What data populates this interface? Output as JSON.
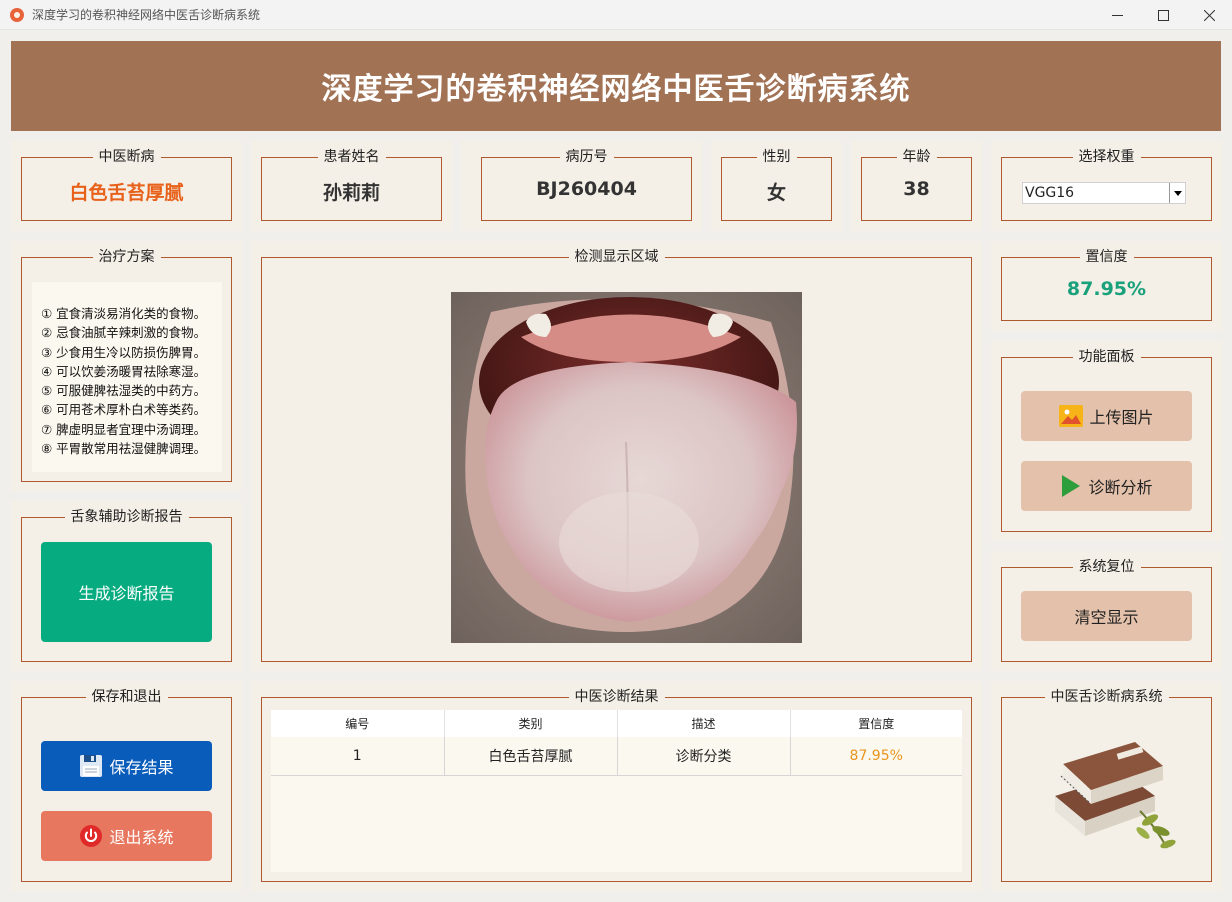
{
  "window": {
    "title": "深度学习的卷积神经网络中医舌诊断病系统",
    "min_label": "—",
    "max_label": "☐",
    "close_label": "✕"
  },
  "header": {
    "title": "深度学习的卷积神经网络中医舌诊断病系统"
  },
  "info": {
    "diagnosis": {
      "label": "中医断病",
      "value": "白色舌苔厚腻"
    },
    "patient_name": {
      "label": "患者姓名",
      "value": "孙莉莉"
    },
    "record_no": {
      "label": "病历号",
      "value": "BJ260404"
    },
    "gender": {
      "label": "性别",
      "value": "女"
    },
    "age": {
      "label": "年龄",
      "value": "38"
    },
    "weights": {
      "label": "选择权重",
      "selected": "VGG16"
    }
  },
  "treatment": {
    "title": "治疗方案",
    "lines": [
      "① 宜食清淡易消化类的食物。",
      "② 忌食油腻辛辣刺激的食物。",
      "③ 少食用生冷以防损伤脾胃。",
      "④ 可以饮姜汤暖胃祛除寒湿。",
      "⑤ 可服健脾祛湿类的中药方。",
      "⑥ 可用苍术厚朴白术等类药。",
      "⑦ 脾虚明显者宜理中汤调理。",
      "⑧ 平胃散常用祛湿健脾调理。"
    ]
  },
  "report": {
    "title": "舌象辅助诊断报告",
    "button": "生成诊断报告"
  },
  "save_exit": {
    "title": "保存和退出",
    "save_button": "保存结果",
    "exit_button": "退出系统"
  },
  "detection": {
    "title": "检测显示区域"
  },
  "confidence": {
    "label": "置信度",
    "value": "87.95%"
  },
  "functions": {
    "title": "功能面板",
    "upload_button": "上传图片",
    "analyze_button": "诊断分析"
  },
  "reset": {
    "title": "系统复位",
    "clear_button": "清空显示"
  },
  "results": {
    "title": "中医诊断结果",
    "columns": [
      "编号",
      "类别",
      "描述",
      "置信度"
    ],
    "rows": [
      {
        "id": "1",
        "category": "白色舌苔厚腻",
        "description": "诊断分类",
        "confidence": "87.95%"
      }
    ]
  },
  "brand": {
    "title": "中医舌诊断病系统"
  },
  "colors": {
    "banner": "#a17254",
    "border": "#b0582e",
    "diagnosis_text": "#e8611a",
    "confidence_text": "#19a17c",
    "report_button": "#07ab80",
    "save_button": "#0a5cba",
    "exit_button": "#e8775f",
    "tan_button": "#e4c1ab"
  }
}
